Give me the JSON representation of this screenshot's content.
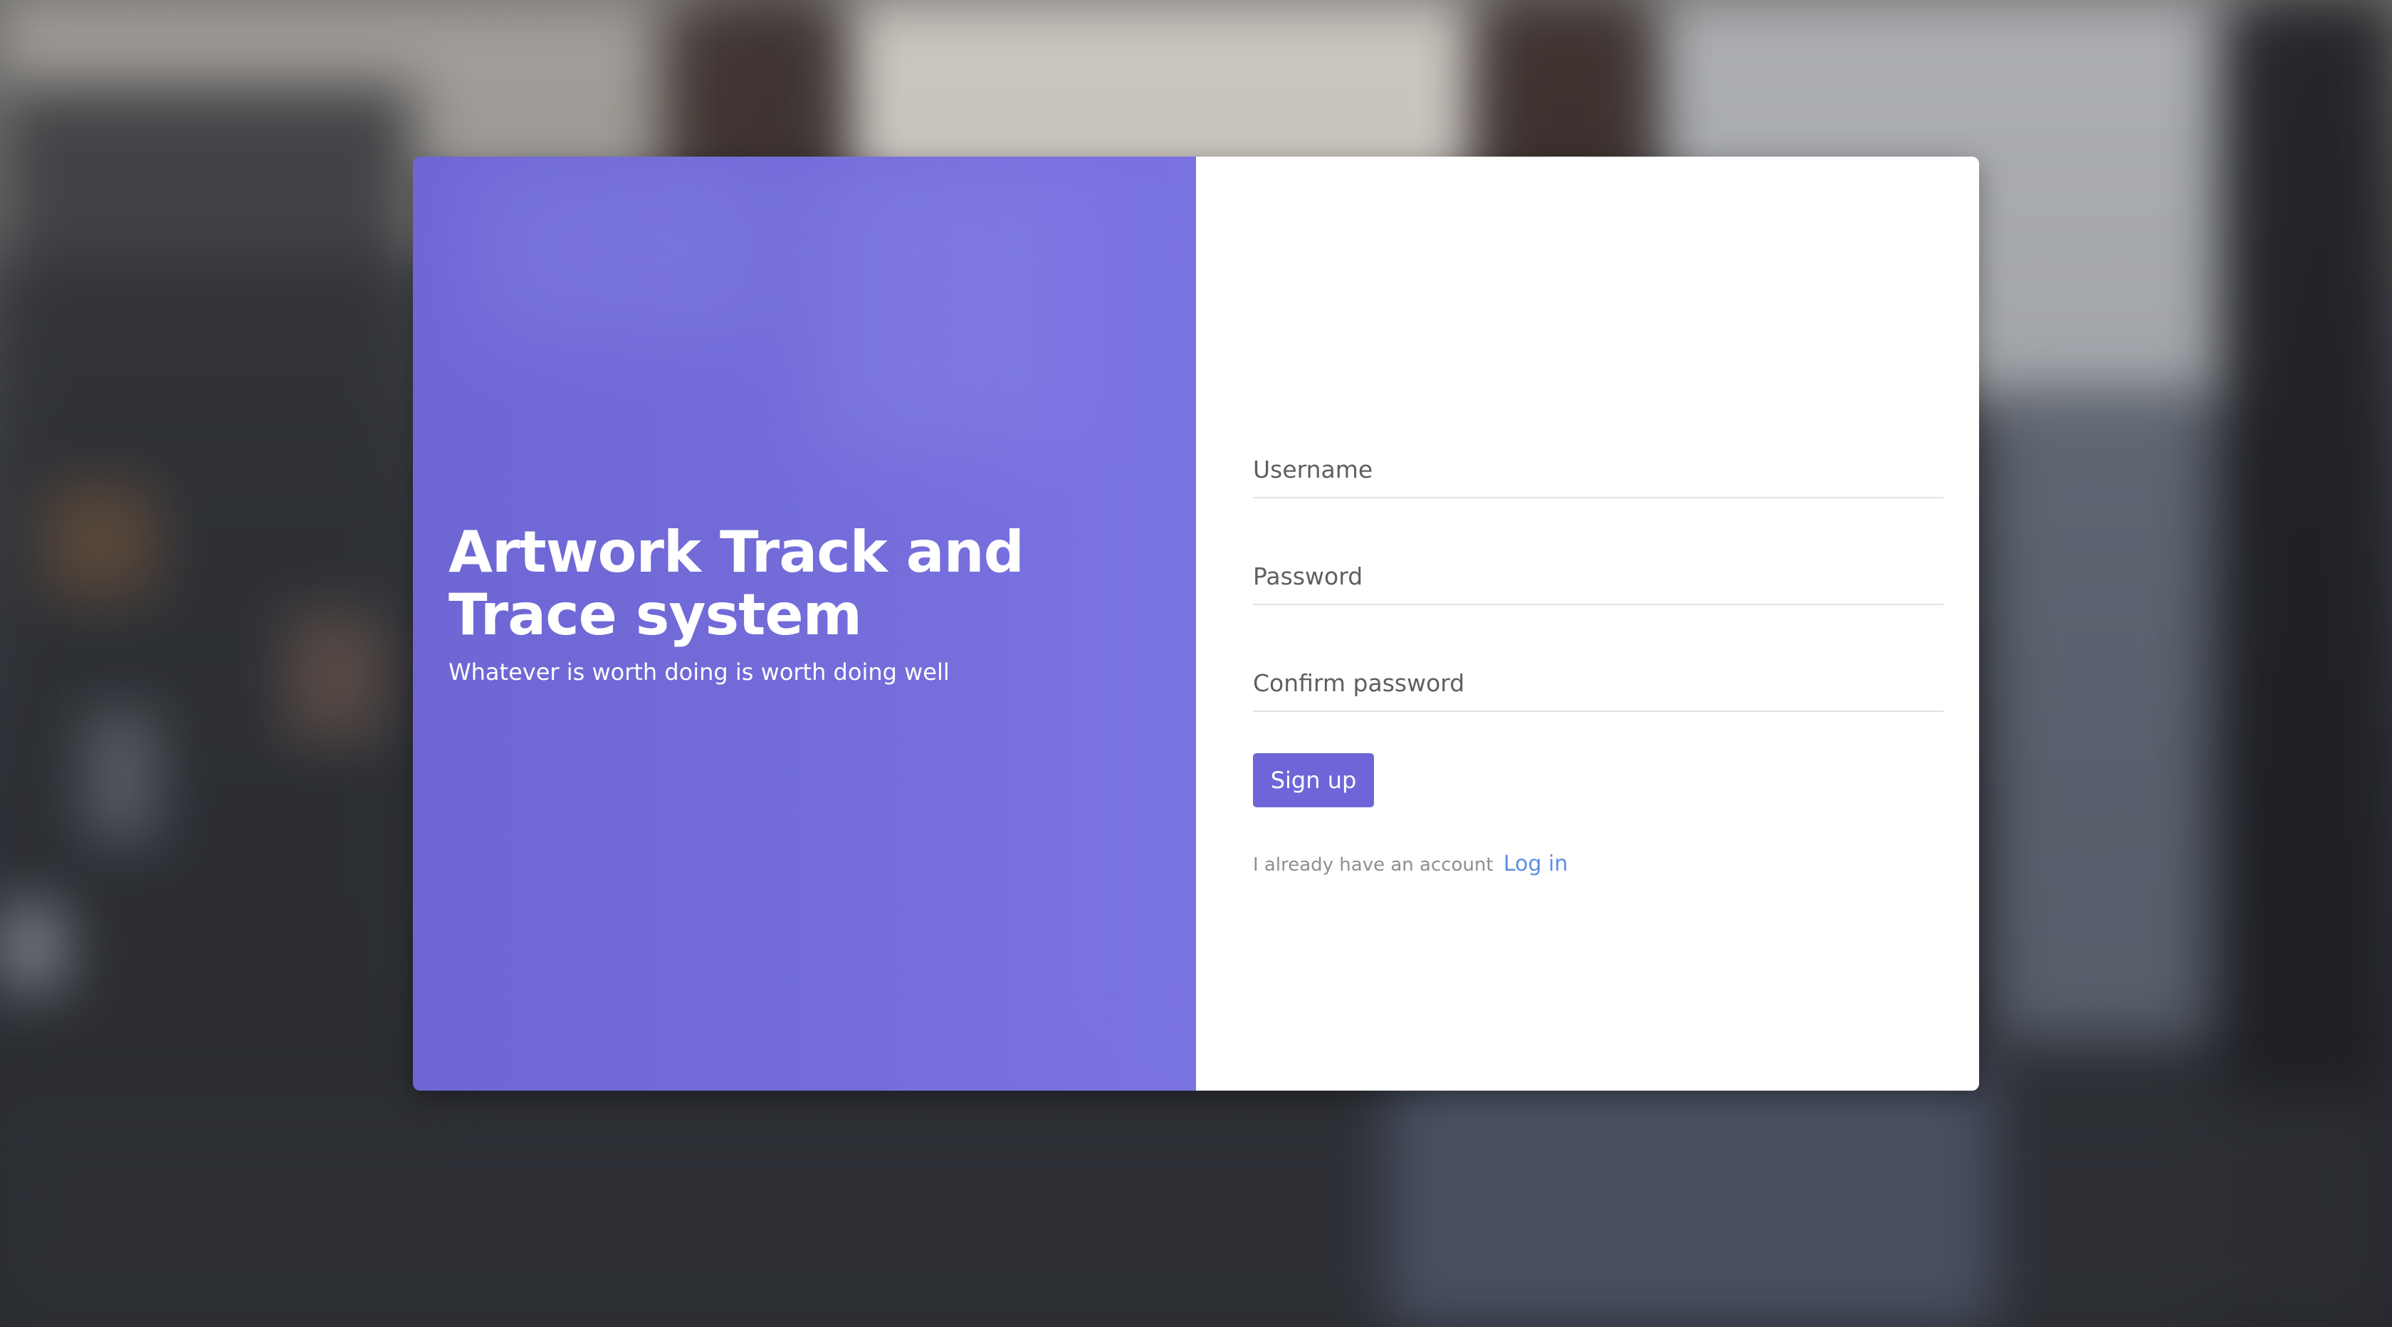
{
  "hero": {
    "title": "Artwork Track and Trace system",
    "subtitle": "Whatever is worth doing is worth doing well"
  },
  "form": {
    "username_placeholder": "Username",
    "password_placeholder": "Password",
    "confirm_password_placeholder": "Confirm password",
    "signup_label": "Sign up",
    "account_prompt": "I already have an account",
    "login_link": "Log in"
  },
  "colors": {
    "accent": "#6e66d8",
    "link": "#5e8fe3"
  }
}
